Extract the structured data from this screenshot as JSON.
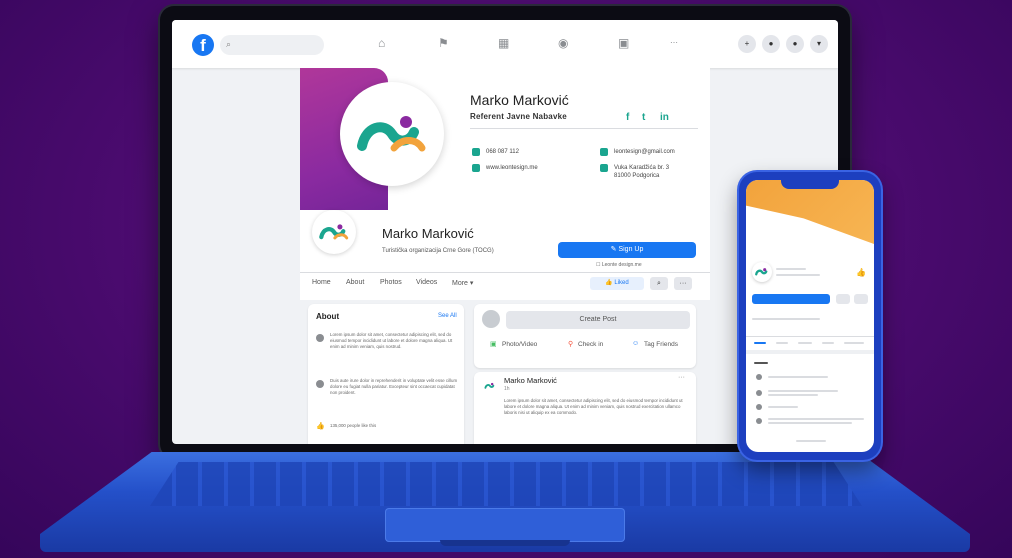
{
  "topbar": {
    "search_placeholder": "",
    "icons": [
      "facebook-logo",
      "search-icon",
      "home-icon",
      "flag-icon",
      "store-icon",
      "groups-icon",
      "gaming-icon",
      "grid-icon",
      "messenger-icon",
      "bell-icon",
      "account-icon",
      "chevron-down-icon"
    ]
  },
  "signature": {
    "name": "Marko Marković",
    "role": "Referent Javne Nabavke",
    "social": [
      "f",
      "t",
      "in"
    ],
    "phone": "068 087 112",
    "website": "www.leontesign.me",
    "email": "leontesign@gmail.com",
    "address_line1": "Vuka Karadžića br. 3",
    "address_line2": "81000 Podgorica"
  },
  "page": {
    "name": "Marko Marković",
    "subtitle": "Turistička organizacija Crne Gore (TOCG)",
    "signup_label": "✎ Sign Up",
    "signup_sub": "☐ Leonte design.me",
    "tabs": [
      "Home",
      "About",
      "Photos",
      "Videos",
      "More ▾"
    ],
    "like_label": "👍 Liked",
    "search_btn": "⌕",
    "more_btn": "···"
  },
  "about": {
    "title": "About",
    "see_all": "See All",
    "entry1": "Lorem ipsum dolor sit amet, consectetur adipiscing elit, sed do eiusmod tempor incididunt ut labore et dolore magna aliqua. Ut enim ad minim veniam, quis nostrud.",
    "entry2": "Duis aute irure dolor in reprehenderit in voluptate velit esse cillum dolore eu fugiat nulla pariatur. Excepteur sint occaecat cupidatat non proident.",
    "likes": "135,000 people like this"
  },
  "create_post": {
    "button": "Create Post",
    "actions": [
      "Photo/Video",
      "Check in",
      "Tag Friends"
    ]
  },
  "post": {
    "author": "Marko Marković",
    "time": "1h",
    "text": "Lorem ipsum dolor sit amet, consectetur adipiscing elit, sed do eiusmod tempor incididunt ut labore et dolore magna aliqua. Ut enim ad minim veniam, quis nostrud exercitation ullamco laboris nisi ut aliquip ex ea commodo."
  },
  "colors": {
    "facebook_blue": "#1877f2",
    "brand_teal": "#1aa58f",
    "brand_purple": "#8a2aa0",
    "brand_orange": "#f2a33c",
    "device_blue": "#2450c9"
  }
}
